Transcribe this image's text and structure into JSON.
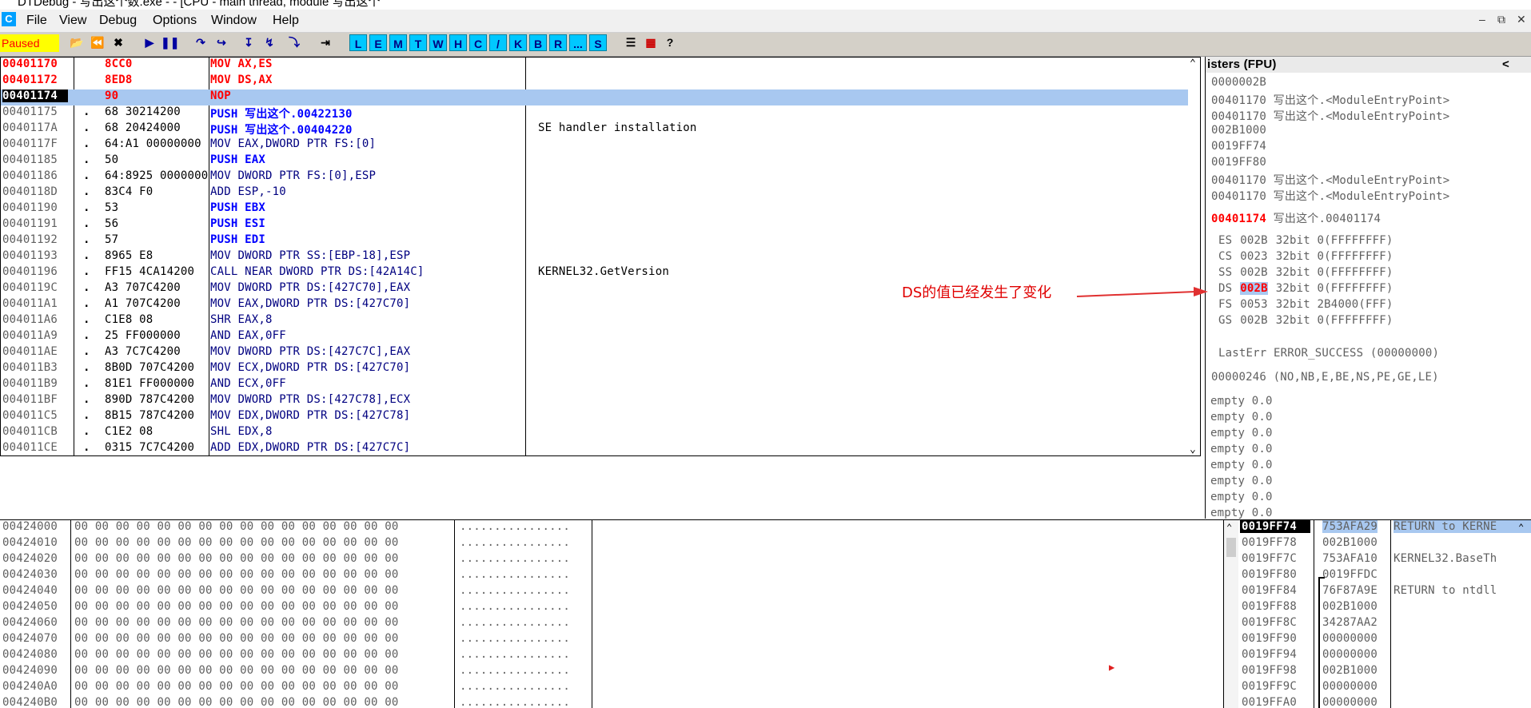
{
  "window": {
    "title": "DTDebug - 写出这个数.exe - - [CPU - main thread, module 写出这个",
    "status": "Paused"
  },
  "menu": [
    "File",
    "View",
    "Debug",
    "Options",
    "Window",
    "Help"
  ],
  "toolbar_letters": [
    "L",
    "E",
    "M",
    "T",
    "W",
    "H",
    "C",
    "/",
    "K",
    "B",
    "R",
    "...",
    "S"
  ],
  "cpu": {
    "rows": [
      {
        "addr": "00401170",
        "dot": "",
        "hex": "8CC0",
        "dis": "MOV AX,ES",
        "comment": "",
        "addr_color": "#ff0000",
        "dis_color": "#ff0000"
      },
      {
        "addr": "00401172",
        "dot": "",
        "hex": "8ED8",
        "dis": "MOV DS,AX",
        "comment": "",
        "addr_color": "#ff0000",
        "dis_color": "#ff0000"
      },
      {
        "addr": "00401174",
        "dot": "",
        "hex": "90",
        "dis": "NOP",
        "comment": "",
        "addr_color": "#ffffff",
        "dis_color": "#ff0000",
        "selected": true
      },
      {
        "addr": "00401175",
        "dot": ".",
        "hex": "68 30214200",
        "dis": "PUSH 写出这个.00422130",
        "comment": "",
        "addr_color": "#606060",
        "dis_color": "#0000ff"
      },
      {
        "addr": "0040117A",
        "dot": ".",
        "hex": "68 20424000",
        "dis": "PUSH 写出这个.00404220",
        "comment": "SE handler installation",
        "addr_color": "#606060",
        "dis_color": "#0000ff"
      },
      {
        "addr": "0040117F",
        "dot": ".",
        "hex": "64:A1 00000000",
        "dis": "MOV EAX,DWORD PTR FS:[0]",
        "comment": "",
        "addr_color": "#606060",
        "dis_color": "#000080"
      },
      {
        "addr": "00401185",
        "dot": ".",
        "hex": "50",
        "dis": "PUSH EAX",
        "comment": "",
        "addr_color": "#606060",
        "dis_color": "#0000ff"
      },
      {
        "addr": "00401186",
        "dot": ".",
        "hex": "64:8925 00000000",
        "dis": "MOV DWORD PTR FS:[0],ESP",
        "comment": "",
        "addr_color": "#606060",
        "dis_color": "#000080"
      },
      {
        "addr": "0040118D",
        "dot": ".",
        "hex": "83C4 F0",
        "dis": "ADD ESP,-10",
        "comment": "",
        "addr_color": "#606060",
        "dis_color": "#000080"
      },
      {
        "addr": "00401190",
        "dot": ".",
        "hex": "53",
        "dis": "PUSH EBX",
        "comment": "",
        "addr_color": "#606060",
        "dis_color": "#0000ff"
      },
      {
        "addr": "00401191",
        "dot": ".",
        "hex": "56",
        "dis": "PUSH ESI",
        "comment": "",
        "addr_color": "#606060",
        "dis_color": "#0000ff"
      },
      {
        "addr": "00401192",
        "dot": ".",
        "hex": "57",
        "dis": "PUSH EDI",
        "comment": "",
        "addr_color": "#606060",
        "dis_color": "#0000ff"
      },
      {
        "addr": "00401193",
        "dot": ".",
        "hex": "8965 E8",
        "dis": "MOV DWORD PTR SS:[EBP-18],ESP",
        "comment": "",
        "addr_color": "#606060",
        "dis_color": "#000080"
      },
      {
        "addr": "00401196",
        "dot": ".",
        "hex": "FF15 4CA14200",
        "dis": "CALL NEAR DWORD PTR DS:[42A14C]",
        "comment": "KERNEL32.GetVersion",
        "addr_color": "#606060",
        "dis_color": "#000080"
      },
      {
        "addr": "0040119C",
        "dot": ".",
        "hex": "A3 707C4200",
        "dis": "MOV DWORD PTR DS:[427C70],EAX",
        "comment": "",
        "addr_color": "#606060",
        "dis_color": "#000080"
      },
      {
        "addr": "004011A1",
        "dot": ".",
        "hex": "A1 707C4200",
        "dis": "MOV EAX,DWORD PTR DS:[427C70]",
        "comment": "",
        "addr_color": "#606060",
        "dis_color": "#000080"
      },
      {
        "addr": "004011A6",
        "dot": ".",
        "hex": "C1E8 08",
        "dis": "SHR EAX,8",
        "comment": "",
        "addr_color": "#606060",
        "dis_color": "#000080"
      },
      {
        "addr": "004011A9",
        "dot": ".",
        "hex": "25 FF000000",
        "dis": "AND EAX,0FF",
        "comment": "",
        "addr_color": "#606060",
        "dis_color": "#000080"
      },
      {
        "addr": "004011AE",
        "dot": ".",
        "hex": "A3 7C7C4200",
        "dis": "MOV DWORD PTR DS:[427C7C],EAX",
        "comment": "",
        "addr_color": "#606060",
        "dis_color": "#000080"
      },
      {
        "addr": "004011B3",
        "dot": ".",
        "hex": "8B0D 707C4200",
        "dis": "MOV ECX,DWORD PTR DS:[427C70]",
        "comment": "",
        "addr_color": "#606060",
        "dis_color": "#000080"
      },
      {
        "addr": "004011B9",
        "dot": ".",
        "hex": "81E1 FF000000",
        "dis": "AND ECX,0FF",
        "comment": "",
        "addr_color": "#606060",
        "dis_color": "#000080"
      },
      {
        "addr": "004011BF",
        "dot": ".",
        "hex": "890D 787C4200",
        "dis": "MOV DWORD PTR DS:[427C78],ECX",
        "comment": "",
        "addr_color": "#606060",
        "dis_color": "#000080"
      },
      {
        "addr": "004011C5",
        "dot": ".",
        "hex": "8B15 787C4200",
        "dis": "MOV EDX,DWORD PTR DS:[427C78]",
        "comment": "",
        "addr_color": "#606060",
        "dis_color": "#000080"
      },
      {
        "addr": "004011CB",
        "dot": ".",
        "hex": "C1E2 08",
        "dis": "SHL EDX,8",
        "comment": "",
        "addr_color": "#606060",
        "dis_color": "#000080"
      },
      {
        "addr": "004011CE",
        "dot": ".",
        "hex": "0315 7C7C4200",
        "dis": "ADD EDX,DWORD PTR DS:[427C7C]",
        "comment": "",
        "addr_color": "#606060",
        "dis_color": "#000080"
      }
    ]
  },
  "registers": {
    "header": "isters (FPU)",
    "collapse_glyph": "<",
    "lines": [
      "0000002B",
      "00401170 写出这个.<ModuleEntryPoint>",
      "00401170 写出这个.<ModuleEntryPoint>",
      "002B1000",
      "0019FF74",
      "0019FF80",
      "00401170 写出这个.<ModuleEntryPoint>",
      "00401170 写出这个.<ModuleEntryPoint>"
    ],
    "eip_value": "00401174",
    "eip_comment": "写出这个.00401174",
    "segments": [
      {
        "name": "ES",
        "val": "002B",
        "rest": "32bit 0(FFFFFFFF)"
      },
      {
        "name": "CS",
        "val": "0023",
        "rest": "32bit 0(FFFFFFFF)"
      },
      {
        "name": "SS",
        "val": "002B",
        "rest": "32bit 0(FFFFFFFF)"
      },
      {
        "name": "DS",
        "val": "002B",
        "rest": "32bit 0(FFFFFFFF)",
        "highlight": true
      },
      {
        "name": "FS",
        "val": "0053",
        "rest": "32bit 2B4000(FFF)"
      },
      {
        "name": "GS",
        "val": "002B",
        "rest": "32bit 0(FFFFFFFF)"
      }
    ],
    "lasterr": "LastErr ERROR_SUCCESS (00000000)",
    "eflags": "00000246 (NO,NB,E,BE,NS,PE,GE,LE)",
    "fpu": [
      "empty 0.0",
      "empty 0.0",
      "empty 0.0",
      "empty 0.0",
      "empty 0.0",
      "empty 0.0",
      "empty 0.0",
      "empty 0.0"
    ]
  },
  "annotation": "DS的值已经发生了变化",
  "dump": {
    "hex": "00 00 00 00 00 00 00 00 00 00 00 00 00 00 00 00",
    "ascii": "................",
    "rows": [
      "00424000",
      "00424010",
      "00424020",
      "00424030",
      "00424040",
      "00424050",
      "00424060",
      "00424070",
      "00424080",
      "00424090",
      "004240A0",
      "004240B0"
    ]
  },
  "stack": {
    "rows": [
      {
        "addr": "0019FF74",
        "val": "753AFA29",
        "comment": "RETURN to KERNE",
        "current": true
      },
      {
        "addr": "0019FF78",
        "val": "002B1000",
        "comment": ""
      },
      {
        "addr": "0019FF7C",
        "val": "753AFA10",
        "comment": "KERNEL32.BaseTh"
      },
      {
        "addr": "0019FF80",
        "val": "0019FFDC",
        "comment": ""
      },
      {
        "addr": "0019FF84",
        "val": "76F87A9E",
        "comment": "RETURN to ntdll"
      },
      {
        "addr": "0019FF88",
        "val": "002B1000",
        "comment": ""
      },
      {
        "addr": "0019FF8C",
        "val": "34287AA2",
        "comment": ""
      },
      {
        "addr": "0019FF90",
        "val": "00000000",
        "comment": ""
      },
      {
        "addr": "0019FF94",
        "val": "00000000",
        "comment": ""
      },
      {
        "addr": "0019FF98",
        "val": "002B1000",
        "comment": ""
      },
      {
        "addr": "0019FF9C",
        "val": "00000000",
        "comment": ""
      },
      {
        "addr": "0019FFA0",
        "val": "00000000",
        "comment": ""
      }
    ]
  }
}
